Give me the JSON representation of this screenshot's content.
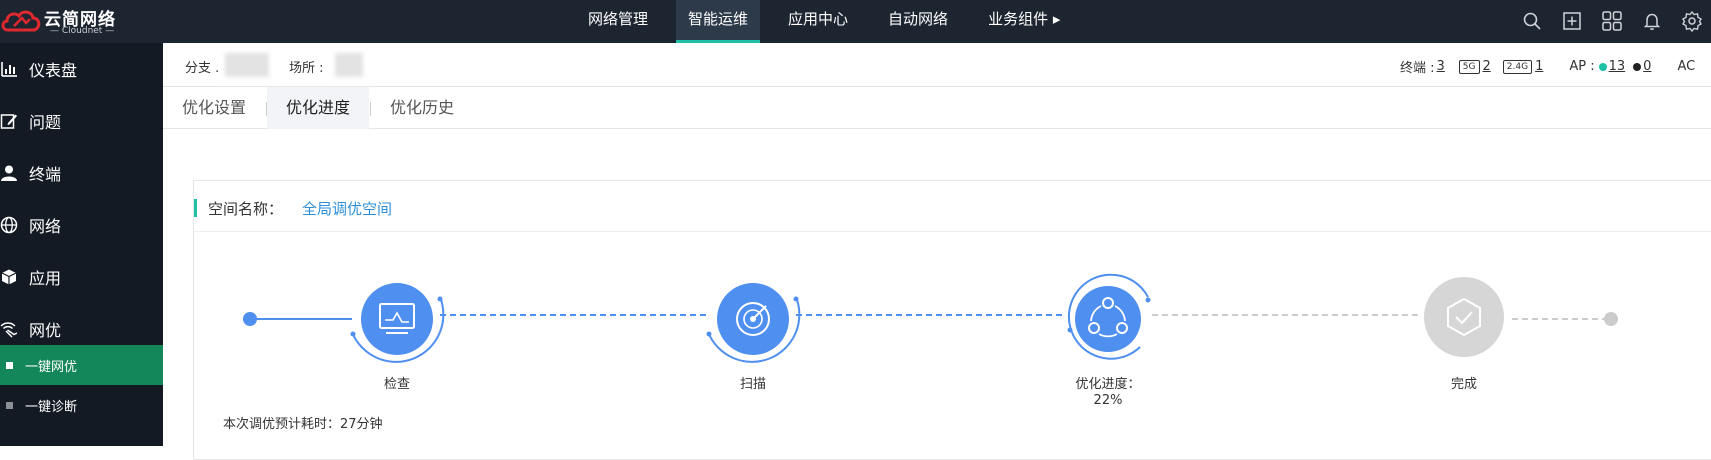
{
  "header": {
    "logo_name": "云简网络",
    "logo_sub": "— Cloudnet —",
    "nav": [
      {
        "label": "网络管理"
      },
      {
        "label": "智能运维",
        "active": true
      },
      {
        "label": "应用中心"
      },
      {
        "label": "自动网络"
      },
      {
        "label": "业务组件 ▸"
      }
    ],
    "icons": [
      "search-icon",
      "add-box-icon",
      "apps-grid-icon",
      "bell-icon",
      "gear-icon"
    ]
  },
  "sidebar": {
    "items": [
      {
        "label": "仪表盘",
        "icon": "dashboard-icon"
      },
      {
        "label": "问题",
        "icon": "edit-icon"
      },
      {
        "label": "终端",
        "icon": "user-icon"
      },
      {
        "label": "网络",
        "icon": "globe-icon"
      },
      {
        "label": "应用",
        "icon": "cube-icon"
      },
      {
        "label": "网优",
        "icon": "wifi-hand-icon"
      }
    ],
    "sub_items": [
      {
        "label": "一键网优",
        "active": true
      },
      {
        "label": "一键诊断"
      }
    ]
  },
  "context": {
    "branch_label": "分支 .",
    "site_label": "场所 :",
    "terminals_label": "终端 :",
    "terminals_count": "3",
    "tag_5g": "5G",
    "count_5g": "2",
    "tag_24g": "2.4G",
    "count_24g": "1",
    "ap_label": "AP :",
    "ap_online": "13",
    "ap_offline": "0",
    "ac_label": "AC",
    "online_color": "#1ec1a5",
    "offline_color": "#222222"
  },
  "tabs": [
    {
      "label": "优化设置"
    },
    {
      "label": "优化进度",
      "active": true
    },
    {
      "label": "优化历史"
    }
  ],
  "panel": {
    "space_label": "空间名称：",
    "space_value": "全局调优空间",
    "steps": [
      {
        "label": "检查",
        "state": "done",
        "icon": "monitor-icon"
      },
      {
        "label": "扫描",
        "state": "done",
        "icon": "radar-icon"
      },
      {
        "label": "优化进度：",
        "progress": "22%",
        "state": "active",
        "icon": "share-nodes-icon"
      },
      {
        "label": "完成",
        "state": "pending",
        "icon": "hex-check-icon"
      }
    ],
    "eta": "本次调优预计耗时：27分钟",
    "accent_color": "#4f8ff0"
  }
}
